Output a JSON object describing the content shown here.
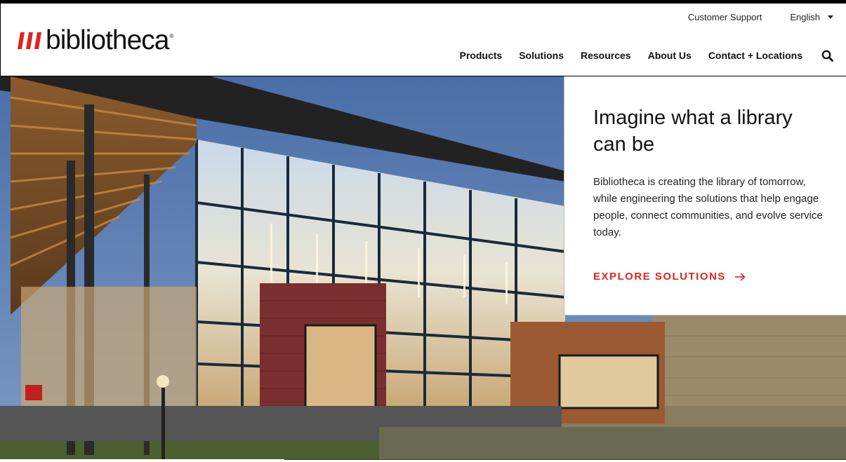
{
  "brand": {
    "name": "bibliotheca",
    "registered": "®",
    "accent_color": "#e1241c"
  },
  "utility_nav": {
    "support_label": "Customer Support",
    "language_label": "English"
  },
  "main_nav": {
    "items": [
      {
        "label": "Products"
      },
      {
        "label": "Solutions"
      },
      {
        "label": "Resources"
      },
      {
        "label": "About Us"
      },
      {
        "label": "Contact + Locations"
      }
    ],
    "search_icon": "search-icon"
  },
  "hero": {
    "title": "Imagine what a library can be",
    "description": "Bibliotheca is creating the library of tomorrow, while engineering the solutions that help engage people, connect communities, and evolve service today.",
    "cta_label": "EXPLORE SOLUTIONS",
    "cta_icon": "arrow-right-icon"
  }
}
